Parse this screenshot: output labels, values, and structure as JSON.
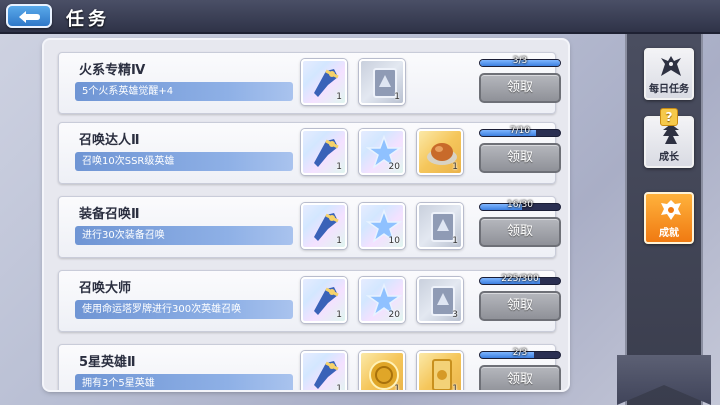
{
  "header": {
    "title": "任务"
  },
  "tasks": [
    {
      "name": "火系专精Ⅳ",
      "desc": "5个火系英雄觉醒+4",
      "progress_text": "3/3",
      "progress": 1.0,
      "claim": "领取",
      "rewards": [
        {
          "icon": "weapon-icon",
          "qty": "1"
        },
        {
          "icon": "card-icon",
          "qty": "1"
        }
      ]
    },
    {
      "name": "召唤达人Ⅱ",
      "desc": "召唤10次SSR级英雄",
      "progress_text": "7/10",
      "progress": 0.7,
      "claim": "领取",
      "rewards": [
        {
          "icon": "weapon-icon",
          "qty": "1"
        },
        {
          "icon": "star-icon",
          "qty": "20"
        },
        {
          "icon": "food-icon",
          "qty": "1"
        }
      ]
    },
    {
      "name": "装备召唤Ⅱ",
      "desc": "进行30次装备召唤",
      "progress_text": "16/30",
      "progress": 0.53,
      "claim": "领取",
      "rewards": [
        {
          "icon": "weapon-icon",
          "qty": "1"
        },
        {
          "icon": "star-icon",
          "qty": "10"
        },
        {
          "icon": "card-icon",
          "qty": "1"
        }
      ]
    },
    {
      "name": "召唤大师",
      "desc": "使用命运塔罗牌进行300次英雄召唤",
      "progress_text": "225/300",
      "progress": 0.75,
      "claim": "领取",
      "rewards": [
        {
          "icon": "weapon-icon",
          "qty": "1"
        },
        {
          "icon": "star-icon",
          "qty": "20"
        },
        {
          "icon": "card-icon",
          "qty": "3"
        }
      ]
    },
    {
      "name": "5星英雄Ⅱ",
      "desc": "拥有3个5星英雄",
      "progress_text": "2/3",
      "progress": 0.67,
      "claim": "领取",
      "rewards": [
        {
          "icon": "weapon-icon",
          "qty": "1"
        },
        {
          "icon": "coin-icon",
          "qty": "1"
        },
        {
          "icon": "scroll-icon",
          "qty": "1"
        }
      ]
    }
  ],
  "sidebar": {
    "tabs": [
      {
        "label": "每日任务",
        "icon": "dragon-icon",
        "active": false
      },
      {
        "label": "成长",
        "icon": "growth-icon",
        "active": false,
        "badge": "?"
      },
      {
        "label": "成就",
        "icon": "crest-icon",
        "active": true
      }
    ]
  },
  "colors": {
    "accent": "#f07a12",
    "desc_bar": "#6f95d4",
    "progress": "#3c7fe0"
  }
}
